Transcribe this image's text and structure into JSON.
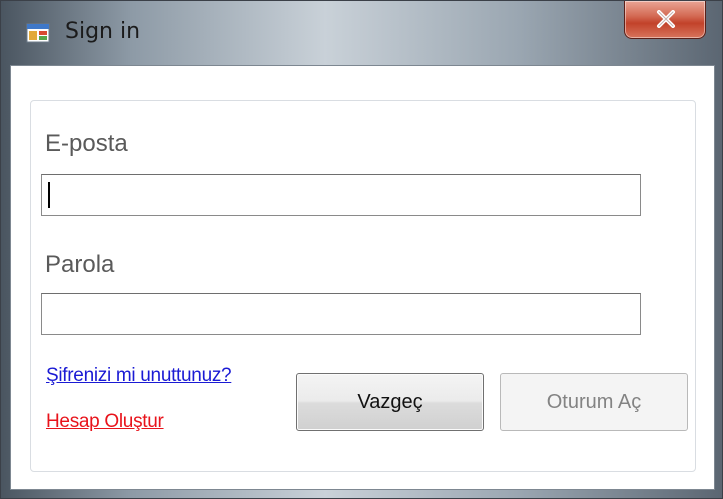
{
  "window": {
    "title": "Sign in",
    "close_symbol": "x"
  },
  "form": {
    "email_label": "E-posta",
    "email_value": "",
    "password_label": "Parola",
    "password_value": "",
    "forgot_password_link": "Şifrenizi mi unuttunuz?",
    "create_account_link": "Hesap Oluştur",
    "cancel_button": "Vazgeç",
    "signin_button": "Oturum Aç"
  },
  "icons": {
    "app": "app-window-icon",
    "close": "close-icon"
  },
  "colors": {
    "forgot_link": "#1a1ad4",
    "create_link": "#e8131b",
    "close_button": "#c2422a"
  }
}
